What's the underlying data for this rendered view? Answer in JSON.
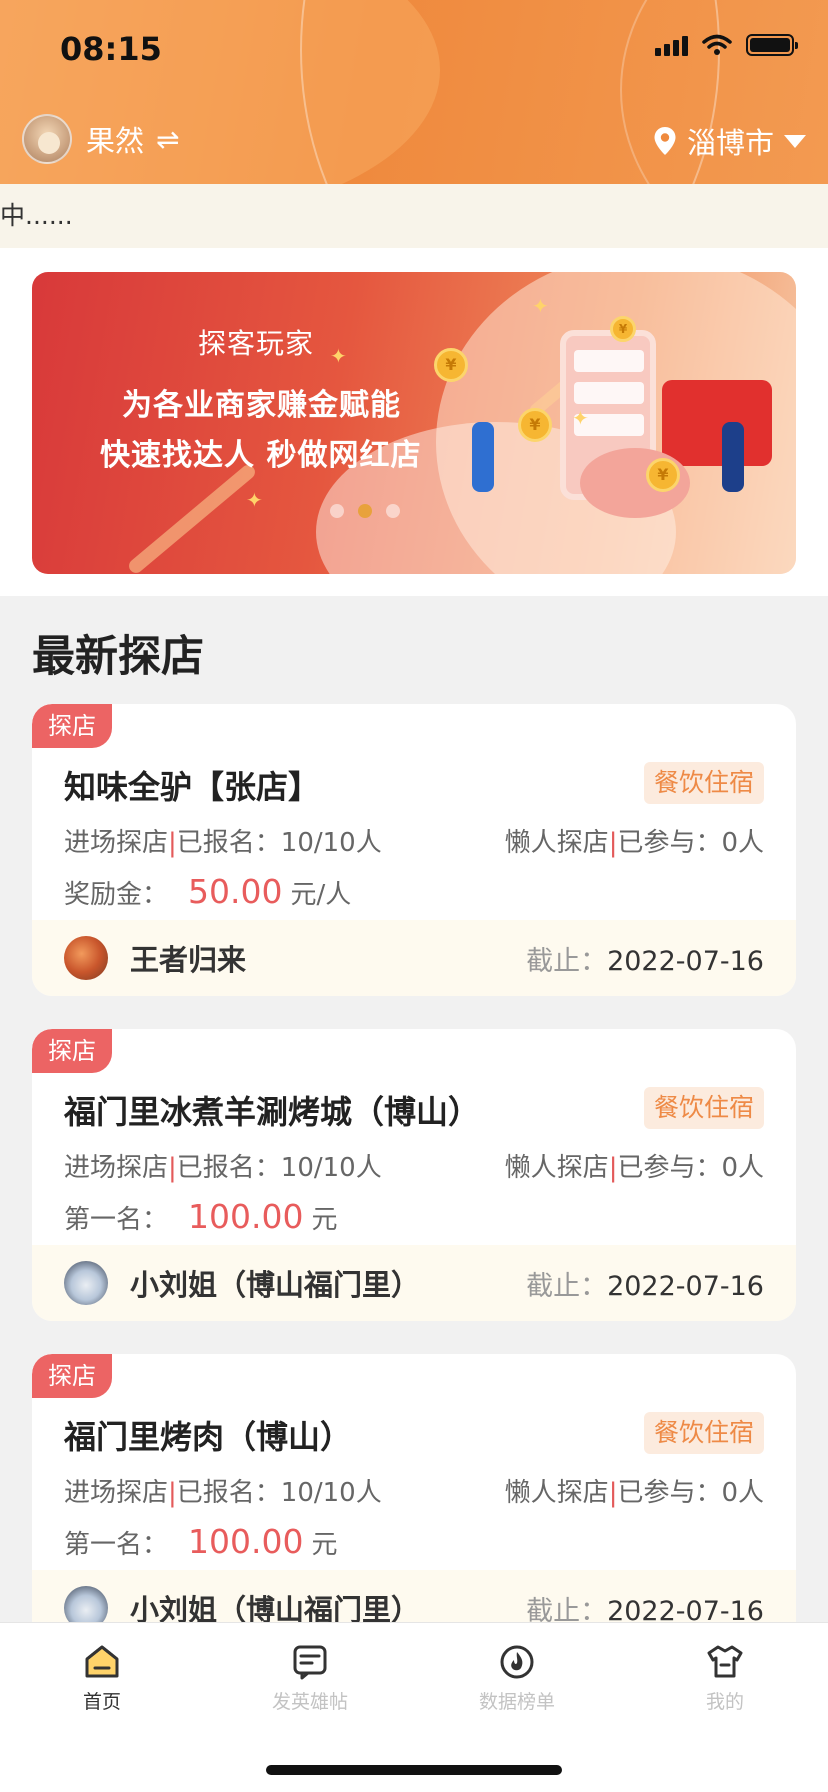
{
  "status_bar": {
    "time": "08:15"
  },
  "header": {
    "username": "果然",
    "swap_icon": "⇌",
    "city": "淄博市"
  },
  "notice": {
    "text": "中......"
  },
  "banner": {
    "brand": "探客玩家",
    "line1": "为各业商家赚金赋能",
    "line2": "快速找达人 秒做网红店",
    "active_dot": 1
  },
  "section": {
    "title": "最新探店"
  },
  "cards": [
    {
      "tag": "探店",
      "title": "知味全驴【张店】",
      "category": "餐饮住宿",
      "enroll_label": "进场探店",
      "enroll_sep": "|",
      "enroll_text": "已报名：10/10人",
      "lazy_label": "懒人探店",
      "lazy_sep": "|",
      "lazy_text": "已参与：0人",
      "reward_label": "奖励金：",
      "reward_amount": "50.00",
      "reward_unit": "元/人",
      "publisher": "王者归来",
      "deadline_label": "截止：",
      "deadline": "2022-07-16"
    },
    {
      "tag": "探店",
      "title": "福门里冰煮羊涮烤城（博山）",
      "category": "餐饮住宿",
      "enroll_label": "进场探店",
      "enroll_sep": "|",
      "enroll_text": "已报名：10/10人",
      "lazy_label": "懒人探店",
      "lazy_sep": "|",
      "lazy_text": "已参与：0人",
      "reward_label": "第一名：",
      "reward_amount": "100.00",
      "reward_unit": "元",
      "publisher": "小刘姐（博山福门里）",
      "deadline_label": "截止：",
      "deadline": "2022-07-16"
    },
    {
      "tag": "探店",
      "title": "福门里烤肉（博山）",
      "category": "餐饮住宿",
      "enroll_label": "进场探店",
      "enroll_sep": "|",
      "enroll_text": "已报名：10/10人",
      "lazy_label": "懒人探店",
      "lazy_sep": "|",
      "lazy_text": "已参与：0人",
      "reward_label": "第一名：",
      "reward_amount": "100.00",
      "reward_unit": "元",
      "publisher": "小刘姐（博山福门里）",
      "deadline_label": "截止：",
      "deadline": "2022-07-16"
    }
  ],
  "tabbar": {
    "items": [
      {
        "label": "首页",
        "icon": "home-icon",
        "active": true
      },
      {
        "label": "发英雄帖",
        "icon": "post-icon",
        "active": false
      },
      {
        "label": "数据榜单",
        "icon": "ranking-icon",
        "active": false
      },
      {
        "label": "我的",
        "icon": "profile-icon",
        "active": false
      }
    ]
  },
  "colors": {
    "brand_orange": "#ef8a3e",
    "tag_red": "#ec6464",
    "reward_red": "#e85c5c",
    "badge_bg": "#fcebde",
    "badge_text": "#ee8a46"
  }
}
